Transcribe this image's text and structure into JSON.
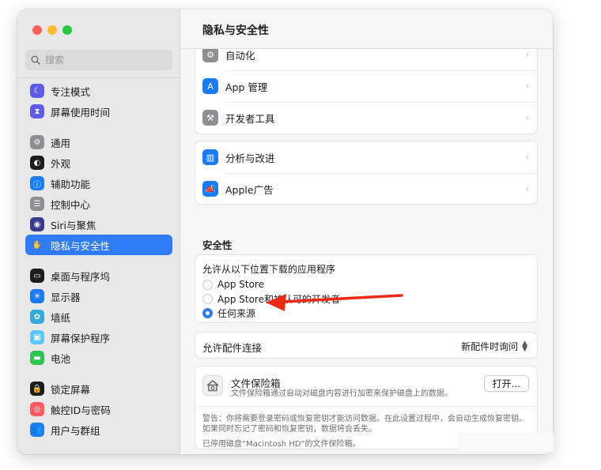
{
  "window": {
    "title": "隐私与安全性"
  },
  "colors": {
    "accent": "#2f7cf6",
    "arrow": "#ee2a16"
  },
  "sidebar": {
    "search_placeholder": "搜索",
    "groups": [
      [
        {
          "label": "专注模式",
          "icon": "moon-icon",
          "color": "#5e5ce6"
        },
        {
          "label": "屏幕使用时间",
          "icon": "hourglass-icon",
          "color": "#5e5ce6"
        }
      ],
      [
        {
          "label": "通用",
          "icon": "gear-icon",
          "color": "#8e8e93"
        },
        {
          "label": "外观",
          "icon": "appearance-icon",
          "color": "#1c1c1e"
        },
        {
          "label": "辅助功能",
          "icon": "accessibility-icon",
          "color": "#1a7cf5"
        },
        {
          "label": "控制中心",
          "icon": "control-center-icon",
          "color": "#8e8e93"
        },
        {
          "label": "Siri与聚焦",
          "icon": "siri-icon",
          "color": "#3a3a8c"
        },
        {
          "label": "隐私与安全性",
          "icon": "hand-icon",
          "color": "#2f7cf6",
          "selected": true
        }
      ],
      [
        {
          "label": "桌面与程序坞",
          "icon": "dock-icon",
          "color": "#1c1c1e"
        },
        {
          "label": "显示器",
          "icon": "display-icon",
          "color": "#1a7cf5"
        },
        {
          "label": "墙纸",
          "icon": "wallpaper-icon",
          "color": "#34aadc"
        },
        {
          "label": "屏幕保护程序",
          "icon": "screensaver-icon",
          "color": "#5ac8fa"
        },
        {
          "label": "电池",
          "icon": "battery-icon",
          "color": "#30c552"
        }
      ],
      [
        {
          "label": "锁定屏幕",
          "icon": "lock-icon",
          "color": "#1c1c1e"
        },
        {
          "label": "触控ID与密码",
          "icon": "fingerprint-icon",
          "color": "#ff5a5f"
        },
        {
          "label": "用户与群组",
          "icon": "users-icon",
          "color": "#1a7cf5"
        }
      ]
    ]
  },
  "main": {
    "group1": [
      {
        "label": "自动化",
        "icon": "automation-icon",
        "color": "#8e8e93"
      },
      {
        "label": "App 管理",
        "icon": "app-store-icon",
        "color": "#1a7cf5"
      },
      {
        "label": "开发者工具",
        "icon": "hammer-icon",
        "color": "#8e8e93"
      }
    ],
    "group2": [
      {
        "label": "分析与改进",
        "icon": "chart-icon",
        "color": "#1a7cf5"
      },
      {
        "label": "Apple广告",
        "icon": "megaphone-icon",
        "color": "#1a7cf5"
      }
    ],
    "security": {
      "section_title": "安全性",
      "allow_label": "允许从以下位置下载的应用程序",
      "options": [
        "App Store",
        "App Store和被认可的开发者",
        "任何来源"
      ],
      "selected_index": 2,
      "accessory_label": "允许配件连接",
      "accessory_value": "新配件时询问"
    },
    "filevault": {
      "title": "文件保险箱",
      "description": "文件保险箱通过自动对磁盘内容进行加密来保护磁盘上的数据。",
      "open_label": "打开...",
      "warning": "警告：你将需要登录密码或恢复密钥才能访问数据。在此设置过程中，会自动生成恢复密钥。如果同时忘记了密码和恢复密钥，数据将会丢失。",
      "status": "已停用磁盘“Macintosh HD”的文件保险箱。"
    }
  }
}
